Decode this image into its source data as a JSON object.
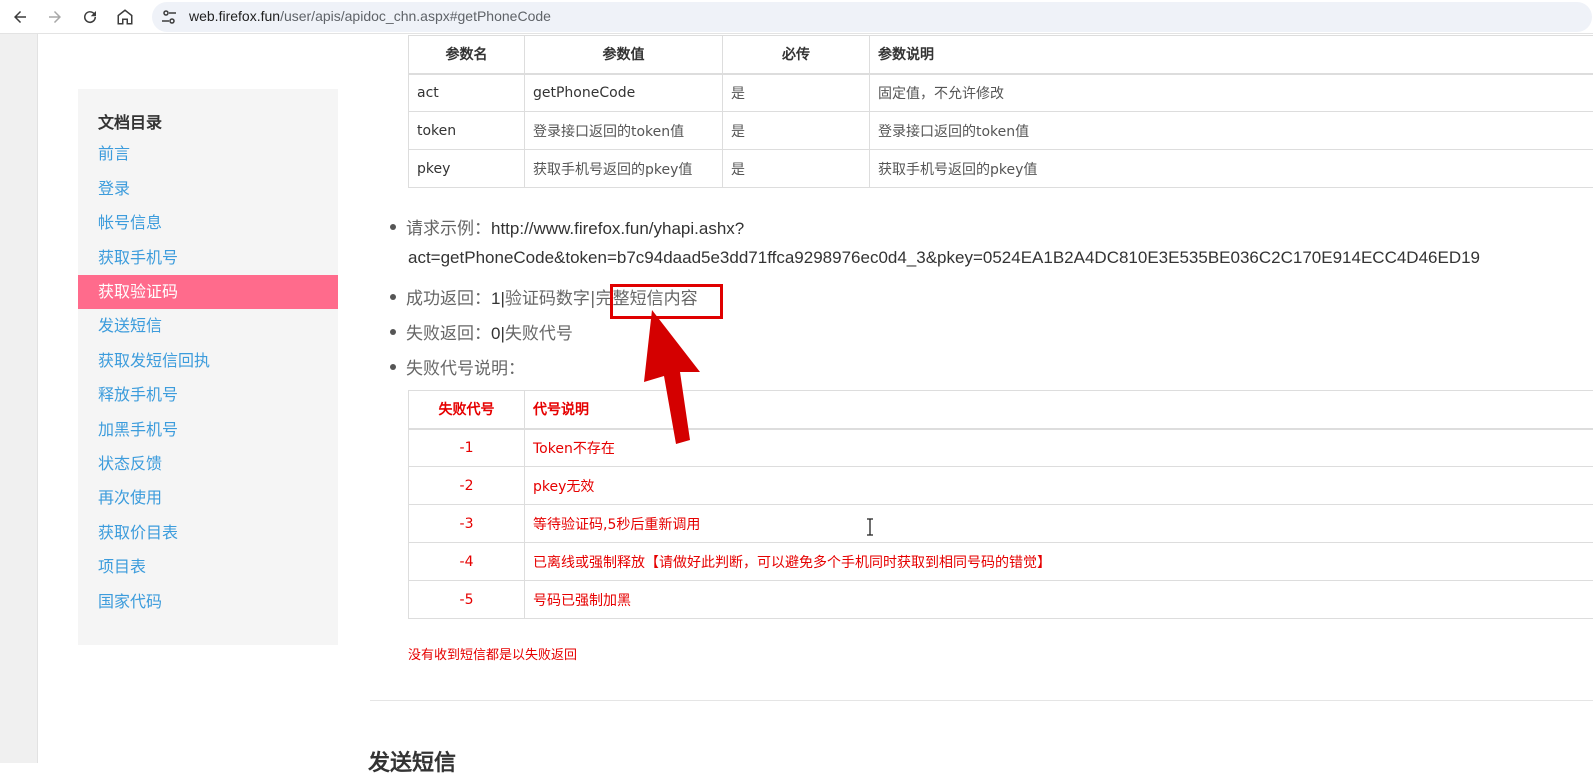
{
  "browser": {
    "url_host": "web.firefox.fun",
    "url_path": "/user/apis/apidoc_chn.aspx#getPhoneCode"
  },
  "sidebar": {
    "title": "文档目录",
    "items": [
      {
        "label": "前言"
      },
      {
        "label": "登录"
      },
      {
        "label": "帐号信息"
      },
      {
        "label": "获取手机号"
      },
      {
        "label": "获取验证码",
        "active": true
      },
      {
        "label": "发送短信"
      },
      {
        "label": "获取发短信回执"
      },
      {
        "label": "释放手机号"
      },
      {
        "label": "加黑手机号"
      },
      {
        "label": "状态反馈"
      },
      {
        "label": "再次使用"
      },
      {
        "label": "获取价目表"
      },
      {
        "label": "项目表"
      },
      {
        "label": "国家代码"
      }
    ]
  },
  "param_table": {
    "headers": [
      "参数名",
      "参数值",
      "必传",
      "参数说明"
    ],
    "rows": [
      [
        "act",
        "getPhoneCode",
        "是",
        "固定值，不允许修改"
      ],
      [
        "token",
        "登录接口返回的token值",
        "是",
        "登录接口返回的token值"
      ],
      [
        "pkey",
        "获取手机号返回的pkey值",
        "是",
        "获取手机号返回的pkey值"
      ]
    ]
  },
  "bullets": {
    "example_label": "请求示例：",
    "example_url_1": "http://www.firefox.fun/yhapi.ashx?",
    "example_url_2": "act=getPhoneCode&token=b7c94daad5e3dd71ffca9298976ec0d4_3&pkey=0524EA1B2A4DC810E3E535BE036C2C170E914ECC4D46ED19",
    "success_label": "成功返回：",
    "success_value_prefix": "1|",
    "success_value_mid": "验证码数字|",
    "success_value_highlight": "完整短信内容",
    "fail_label": "失败返回：",
    "fail_value_prefix": "0|",
    "fail_value_text": "失败代号",
    "fail_code_desc_label": "失败代号说明："
  },
  "err_table": {
    "headers": [
      "失败代号",
      "代号说明"
    ],
    "rows": [
      [
        "-1",
        "Token不存在"
      ],
      [
        "-2",
        "pkey无效"
      ],
      [
        "-3",
        "等待验证码,5秒后重新调用"
      ],
      [
        "-4",
        "已离线或强制释放【请做好此判断，可以避免多个手机同时获取到相同号码的错觉】"
      ],
      [
        "-5",
        "号码已强制加黑"
      ]
    ]
  },
  "note": "没有收到短信都是以失败返回",
  "next_section_heading": "发送短信",
  "colors": {
    "sidebar_active_bg": "#ff6b8c",
    "sidebar_link": "#3c9cdc",
    "error_red": "#e60000",
    "annotation_red": "#e00000"
  }
}
